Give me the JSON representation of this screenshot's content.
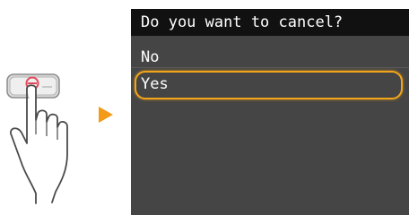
{
  "screen": {
    "title": "Do you want to cancel?",
    "options": [
      {
        "label": "No",
        "selected": false
      },
      {
        "label": "Yes",
        "selected": true
      }
    ]
  },
  "colors": {
    "screen_background": "#454545",
    "header_background": "#111111",
    "selection_outline": "#f2a51a",
    "arrow": "#f39a17",
    "stop_key": "#e04a5a"
  },
  "icons": {
    "hand": "hand-pressing-stop-key-icon",
    "arrow": "play-arrow-icon"
  }
}
